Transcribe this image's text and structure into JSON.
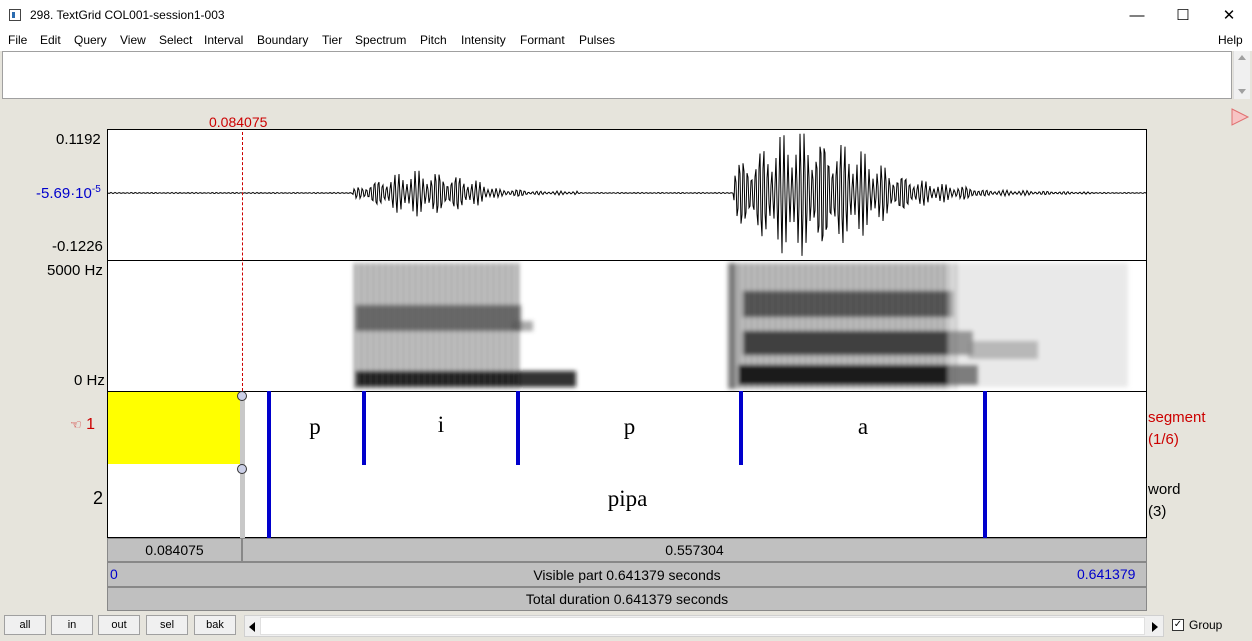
{
  "window": {
    "title": "298. TextGrid COL001-session1-003",
    "controls": {
      "minimize": "—",
      "maximize": "☐",
      "close": "✕"
    }
  },
  "menu": {
    "items": [
      "File",
      "Edit",
      "Query",
      "View",
      "Select",
      "Interval",
      "Boundary",
      "Tier",
      "Spectrum",
      "Pitch",
      "Intensity",
      "Formant",
      "Pulses"
    ],
    "help": "Help"
  },
  "cursor": {
    "time_label": "0.084075"
  },
  "waveform": {
    "max_label": "0.1192",
    "mid_label_base": "-5.69·10",
    "mid_label_exp": "-5",
    "min_label": "-0.1226"
  },
  "spectrogram": {
    "top_label": "5000 Hz",
    "bottom_label": "0 Hz"
  },
  "tiers": [
    {
      "number": "1",
      "marker": "☜",
      "name": "segment",
      "count": "(1/6)",
      "intervals": [
        "p",
        "i",
        "p",
        "a"
      ]
    },
    {
      "number": "2",
      "name": "word",
      "count": "(3)",
      "intervals": [
        "pipa"
      ]
    }
  ],
  "bars": {
    "selection_left": "0.084075",
    "selection_right": "0.557304",
    "visible_start": "0",
    "visible_text": "Visible part 0.641379 seconds",
    "visible_end": "0.641379",
    "total_text": "Total duration 0.641379 seconds"
  },
  "buttons": {
    "all": "all",
    "in": "in",
    "out": "out",
    "sel": "sel",
    "bak": "bak"
  },
  "group": {
    "label": "Group",
    "checked": true
  },
  "colors": {
    "cursor": "#cc0000",
    "boundary": "#0000cc",
    "selection": "#ffff00",
    "blue_text": "#0000cc"
  }
}
